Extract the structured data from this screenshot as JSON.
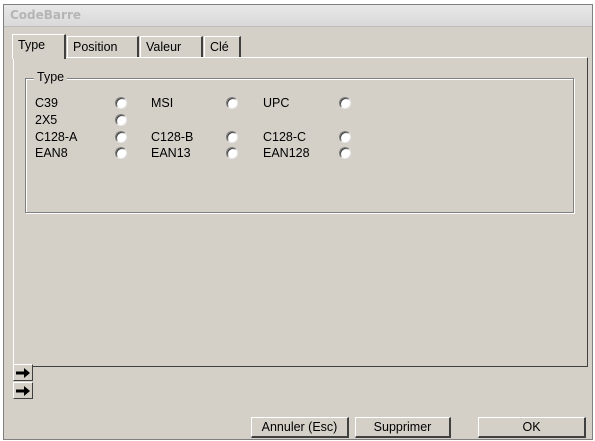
{
  "window": {
    "title": "CodeBarre"
  },
  "tabs": [
    {
      "label": "Type",
      "active": true
    },
    {
      "label": "Position",
      "active": false
    },
    {
      "label": "Valeur",
      "active": false
    },
    {
      "label": "Clé",
      "active": false
    }
  ],
  "group": {
    "label": "Type",
    "options": [
      {
        "label": "C39",
        "selected": false
      },
      {
        "label": "MSI",
        "selected": false
      },
      {
        "label": "UPC",
        "selected": false
      },
      {
        "label": "2X5",
        "selected": false
      },
      {
        "label": "C128-A",
        "selected": false
      },
      {
        "label": "C128-B",
        "selected": false
      },
      {
        "label": "C128-C",
        "selected": false
      },
      {
        "label": "EAN8",
        "selected": false
      },
      {
        "label": "EAN13",
        "selected": false
      },
      {
        "label": "EAN128",
        "selected": false
      }
    ]
  },
  "nav_arrows": [
    "arrow-right-icon",
    "arrow-right-icon"
  ],
  "buttons": {
    "cancel": "Annuler (Esc)",
    "delete": "Supprimer",
    "ok": "OK"
  }
}
